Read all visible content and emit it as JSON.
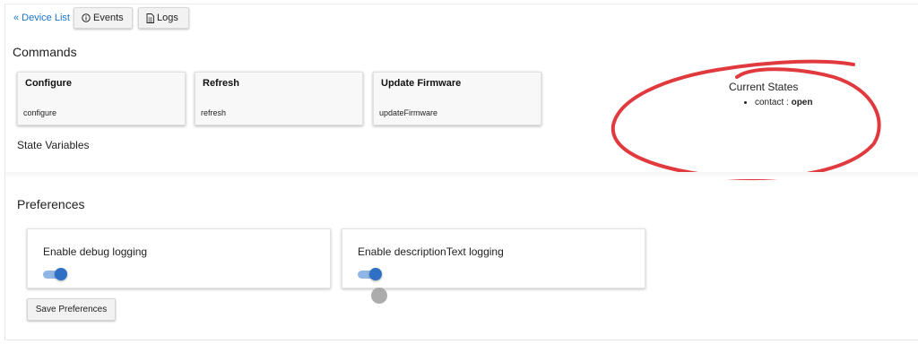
{
  "nav": {
    "device_list_link": "« Device List",
    "events_button": "Events",
    "logs_button": "Logs"
  },
  "commands": {
    "title": "Commands",
    "items": [
      {
        "name": "Configure",
        "method": "configure"
      },
      {
        "name": "Refresh",
        "method": "refresh"
      },
      {
        "name": "Update Firmware",
        "method": "updateFirmware"
      }
    ]
  },
  "state_variables": {
    "title": "State Variables"
  },
  "current_states": {
    "title": "Current States",
    "items": [
      {
        "key": "contact",
        "separator": " : ",
        "value": "open"
      }
    ],
    "annotation_color": "#e03a3e"
  },
  "preferences": {
    "title": "Preferences",
    "items": [
      {
        "label": "Enable debug logging",
        "enabled": true
      },
      {
        "label": "Enable descriptionText logging",
        "enabled": true
      }
    ],
    "save_button": "Save Preferences"
  },
  "icons": {
    "events": "info-icon",
    "logs": "document-icon"
  },
  "colors": {
    "link": "#1a73c7",
    "toggle_on": "#2f6fc4",
    "toggle_track": "#8fb6e5"
  }
}
